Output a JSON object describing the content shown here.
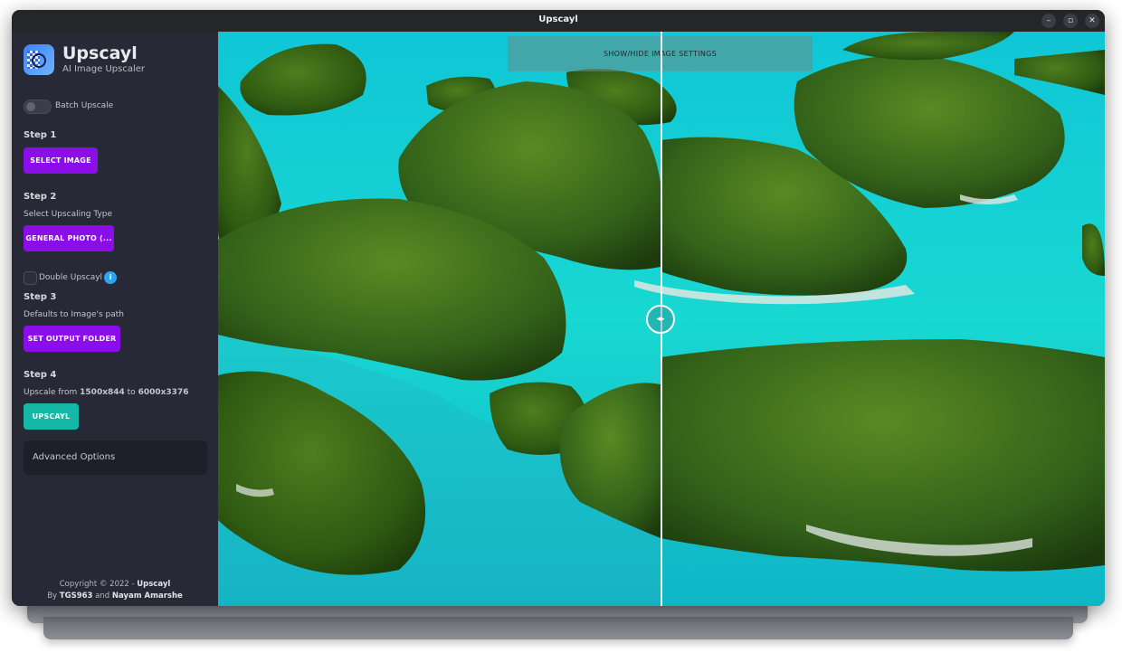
{
  "window": {
    "title": "Upscayl",
    "controls": {
      "minimize": "–",
      "maximize": "▫",
      "close": "✕"
    }
  },
  "sidebar": {
    "app_name": "Upscayl",
    "app_subtitle": "AI Image Upscaler",
    "batch_label": "Batch Upscale",
    "step1": {
      "title": "Step 1",
      "button": "SELECT IMAGE"
    },
    "step2": {
      "title": "Step 2",
      "caption": "Select Upscaling Type",
      "button": "GENERAL PHOTO (...",
      "double_label": "Double Upscayl",
      "info_glyph": "i"
    },
    "step3": {
      "title": "Step 3",
      "caption": "Defaults to Image's path",
      "button": "SET OUTPUT FOLDER"
    },
    "step4": {
      "title": "Step 4",
      "caption_prefix": "Upscale from ",
      "from_size": "1500x844",
      "caption_mid": " to ",
      "to_size": "6000x3376",
      "button": "UPSCAYL"
    },
    "advanced": "Advanced Options",
    "footer": {
      "line1_prefix": "Copyright © 2022 - ",
      "line1_bold": "Upscayl",
      "line2_prefix": "By ",
      "author1": "TGS963",
      "line2_mid": " and ",
      "author2": "Nayam Amarshe"
    }
  },
  "viewer": {
    "settings_toggle": "SHOW/HIDE IMAGE SETTINGS",
    "handle_glyph": "◂▸"
  },
  "colors": {
    "accent_purple": "#8b0ee8",
    "accent_teal": "#14b8a6",
    "sidebar_bg": "#272a36"
  },
  "icons": [
    "upscayl-logo-icon",
    "minimize-icon",
    "maximize-icon",
    "close-icon",
    "info-icon",
    "slider-handle-icon"
  ]
}
